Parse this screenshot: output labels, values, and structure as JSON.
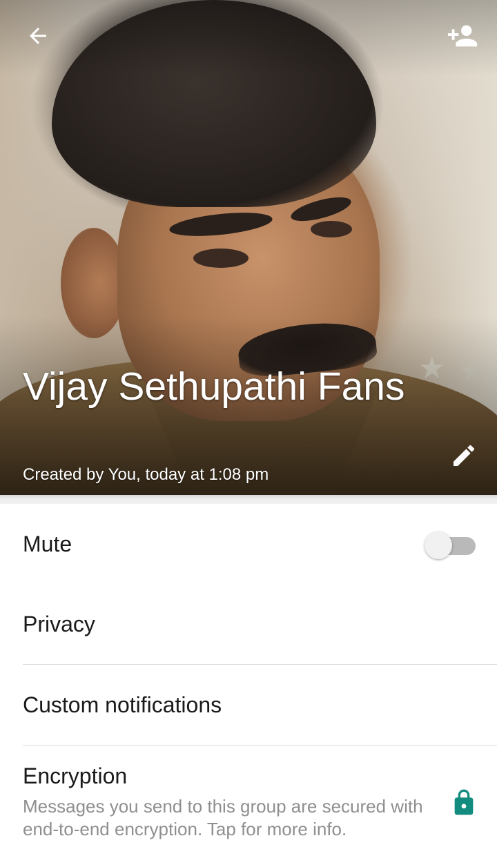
{
  "header": {
    "group_name": "Vijay Sethupathi Fans",
    "created_text": "Created by You, today at 1:08 pm",
    "back_icon": "arrow-back-icon",
    "add_participant_icon": "person-add-icon",
    "edit_icon": "pencil-icon"
  },
  "settings": {
    "mute": {
      "label": "Mute",
      "enabled": false
    },
    "privacy": {
      "label": "Privacy"
    },
    "custom_notifications": {
      "label": "Custom notifications"
    },
    "encryption": {
      "label": "Encryption",
      "description": "Messages you send to this group are secured with end-to-end encryption. Tap for more info.",
      "icon": "lock-icon"
    }
  },
  "colors": {
    "accent": "#128C7E",
    "text_primary": "#1a1a1a",
    "text_secondary": "#8f8f8f",
    "divider": "#dcdcdc"
  }
}
